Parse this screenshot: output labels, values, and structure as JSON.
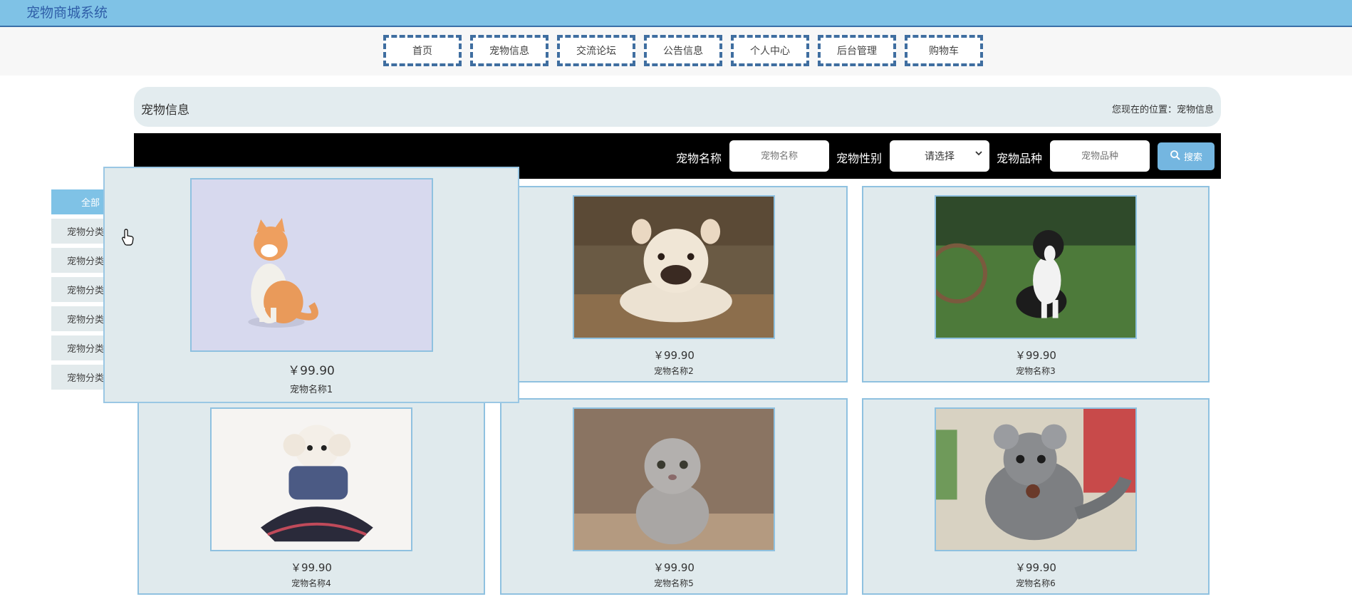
{
  "app": {
    "title": "宠物商城系统"
  },
  "nav": [
    "首页",
    "宠物信息",
    "交流论坛",
    "公告信息",
    "个人中心",
    "后台管理",
    "购物车"
  ],
  "page": {
    "title": "宠物信息",
    "breadcrumb": "您现在的位置：宠物信息"
  },
  "search": {
    "name_label": "宠物名称",
    "name_placeholder": "宠物名称",
    "gender_label": "宠物性别",
    "gender_selected": "请选择",
    "breed_label": "宠物品种",
    "breed_placeholder": "宠物品种",
    "button": "搜索"
  },
  "categories": [
    "全部",
    "宠物分类",
    "宠物分类",
    "宠物分类",
    "宠物分类",
    "宠物分类",
    "宠物分类"
  ],
  "products": [
    {
      "price": "￥99.90",
      "name": "宠物名称1",
      "image": "orange-white-cat"
    },
    {
      "price": "￥99.90",
      "name": "宠物名称2",
      "image": "french-bulldog"
    },
    {
      "price": "￥99.90",
      "name": "宠物名称3",
      "image": "border-collie"
    },
    {
      "price": "￥99.90",
      "name": "宠物名称4",
      "image": "white-poodle-in-dress"
    },
    {
      "price": "￥99.90",
      "name": "宠物名称5",
      "image": "grey-fold-kitten"
    },
    {
      "price": "￥99.90",
      "name": "宠物名称6",
      "image": "chinchilla"
    }
  ],
  "colors": {
    "topbar": "#7fc2e6",
    "accent": "#3f6ea0",
    "card": "#e0eaed",
    "search_bg": "#000000"
  }
}
